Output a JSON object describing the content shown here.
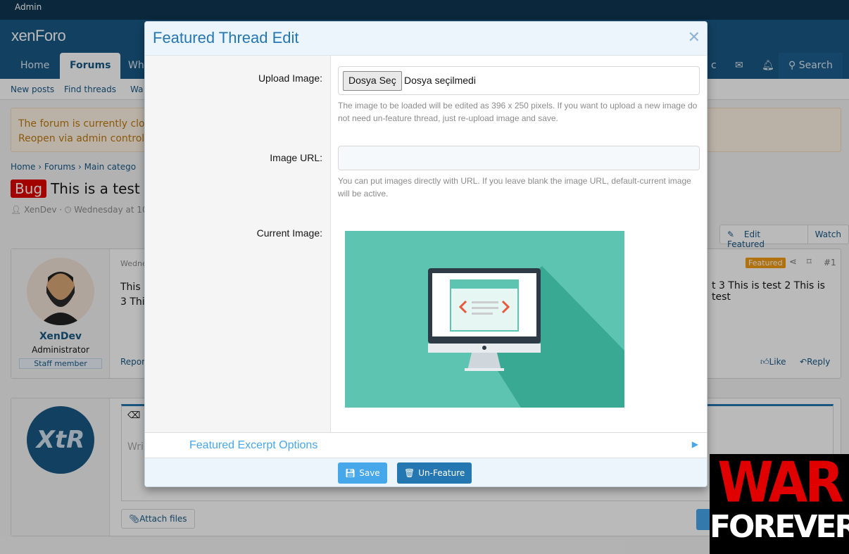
{
  "topbar": {
    "admin": "Admin"
  },
  "header": {
    "logo": "xenForo",
    "nav": [
      "Home",
      "Forums",
      "Wh"
    ],
    "right": [
      "c",
      "Search"
    ]
  },
  "subnav": [
    "New posts",
    "Find threads",
    "Wa"
  ],
  "notice": {
    "line1": "The forum is currently close",
    "line2": "Reopen via admin control p"
  },
  "breadcrumb": [
    "Home",
    "Forums",
    "Main catego"
  ],
  "thread": {
    "prefix": "Bug",
    "title": "This is a test",
    "author": "XenDev",
    "date": "Wednesday at 10:2"
  },
  "actions": {
    "edit_featured": "Edit Featured",
    "watch": "Watch"
  },
  "post": {
    "date": "Wedne",
    "badge": "Featured",
    "number": "#1",
    "body_left": "This i",
    "body_left2": "3 This",
    "body_right": "t 3 This is test 2 This is test",
    "report": "Repor",
    "like": "Like",
    "reply": "Reply",
    "username": "XenDev",
    "role": "Administrator",
    "staff": "Staff member"
  },
  "reply": {
    "placeholder": "Wri",
    "attach": "Attach files"
  },
  "modal": {
    "title": "Featured Thread Edit",
    "upload_label": "Upload Image:",
    "file_button": "Dosya Seç",
    "file_status": "Dosya seçilmedi",
    "upload_hint": "The image to be loaded will be edited as 396 x 250 pixels. If you want to upload a new image do not need un-feature thread, just re-upload image and save.",
    "url_label": "Image URL:",
    "url_value": "",
    "url_hint": "You can put images directly with URL. If you leave blank the image URL, default-current image will be active.",
    "current_label": "Current Image:",
    "excerpt": "Featured Excerpt Options",
    "save": "Save",
    "unfeature": "Un-Feature"
  },
  "watermark": {
    "line1": "WAR",
    "line2": "FOREVER"
  },
  "colors": {
    "accent": "#2577b1",
    "header": "#185886",
    "save": "#47a7eb",
    "unfeature": "#2577b1",
    "featured_badge": "#f39c12",
    "prefix": "#e00000"
  }
}
